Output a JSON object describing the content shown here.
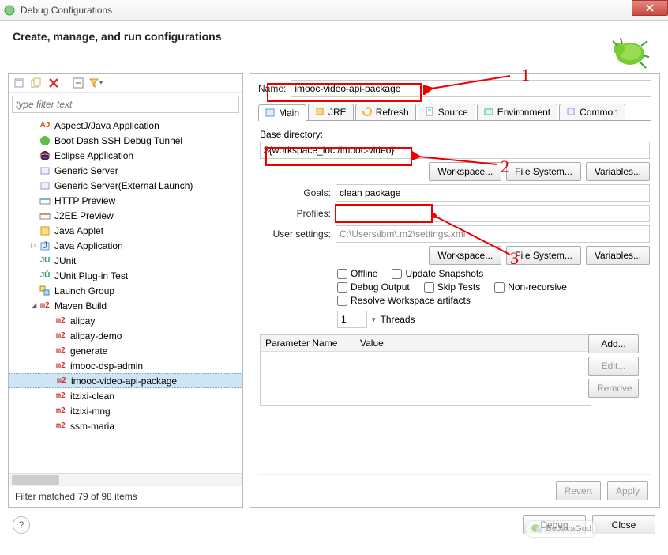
{
  "window": {
    "title": "Debug Configurations"
  },
  "header": {
    "title": "Create, manage, and run configurations"
  },
  "left": {
    "filter_placeholder": "type filter text",
    "status": "Filter matched 79 of 98 items",
    "items": [
      {
        "label": "AspectJ/Java Application",
        "icon": "aj",
        "lvl": 1
      },
      {
        "label": "Boot Dash SSH Debug Tunnel",
        "icon": "boot",
        "lvl": 1
      },
      {
        "label": "Eclipse Application",
        "icon": "eclipse",
        "lvl": 1
      },
      {
        "label": "Generic Server",
        "icon": "srv",
        "lvl": 1
      },
      {
        "label": "Generic Server(External Launch)",
        "icon": "srv",
        "lvl": 1
      },
      {
        "label": "HTTP Preview",
        "icon": "http",
        "lvl": 1
      },
      {
        "label": "J2EE Preview",
        "icon": "j2ee",
        "lvl": 1
      },
      {
        "label": "Java Applet",
        "icon": "applet",
        "lvl": 1
      },
      {
        "label": "Java Application",
        "icon": "java",
        "lvl": 1,
        "exp": "▷"
      },
      {
        "label": "JUnit",
        "icon": "ju",
        "lvl": 1
      },
      {
        "label": "JUnit Plug-in Test",
        "icon": "jup",
        "lvl": 1
      },
      {
        "label": "Launch Group",
        "icon": "grp",
        "lvl": 1
      },
      {
        "label": "Maven Build",
        "icon": "m2",
        "lvl": 1,
        "exp": "◢"
      },
      {
        "label": "alipay",
        "icon": "m2",
        "lvl": 2
      },
      {
        "label": "alipay-demo",
        "icon": "m2",
        "lvl": 2
      },
      {
        "label": "generate",
        "icon": "m2",
        "lvl": 2
      },
      {
        "label": "imooc-dsp-admin",
        "icon": "m2",
        "lvl": 2
      },
      {
        "label": "imooc-video-api-package",
        "icon": "m2",
        "lvl": 2,
        "selected": true
      },
      {
        "label": "itzixi-clean",
        "icon": "m2",
        "lvl": 2
      },
      {
        "label": "itzixi-mng",
        "icon": "m2",
        "lvl": 2
      },
      {
        "label": "ssm-maria",
        "icon": "m2",
        "lvl": 2
      }
    ]
  },
  "right": {
    "name_label": "Name:",
    "name_value": "imooc-video-api-package",
    "tabs": [
      "Main",
      "JRE",
      "Refresh",
      "Source",
      "Environment",
      "Common"
    ],
    "base_dir_label": "Base directory:",
    "base_dir_value": "${workspace_loc:/imooc-video}",
    "goals_label": "Goals:",
    "goals_value": "clean package",
    "profiles_label": "Profiles:",
    "profiles_value": "",
    "user_settings_label": "User settings:",
    "user_settings_value": "C:\\Users\\ibm\\.m2\\settings.xml",
    "btn_workspace": "Workspace...",
    "btn_filesystem": "File System...",
    "btn_variables": "Variables...",
    "chk_offline": "Offline",
    "chk_update": "Update Snapshots",
    "chk_debug": "Debug Output",
    "chk_skip": "Skip Tests",
    "chk_nonrec": "Non-recursive",
    "chk_resolve": "Resolve Workspace artifacts",
    "threads_label": "Threads",
    "threads_value": "1",
    "param_name_hdr": "Parameter Name",
    "param_value_hdr": "Value",
    "btn_add": "Add...",
    "btn_edit": "Edit...",
    "btn_remove": "Remove",
    "btn_revert": "Revert",
    "btn_apply": "Apply"
  },
  "footer": {
    "btn_debug": "Debug",
    "btn_close": "Close"
  },
  "annotations": {
    "a1": "1",
    "a2": "2",
    "a3": "3"
  }
}
